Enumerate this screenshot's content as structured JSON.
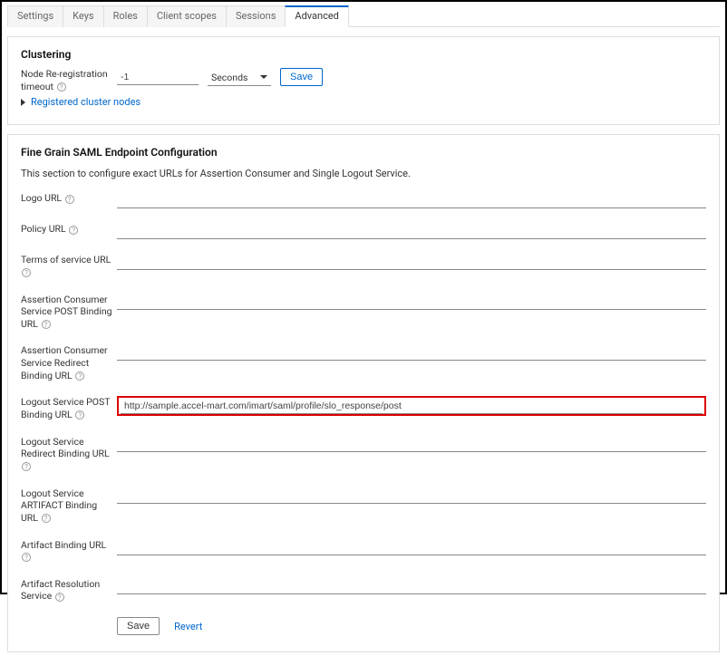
{
  "tabs": {
    "settings": "Settings",
    "keys": "Keys",
    "roles": "Roles",
    "client_scopes": "Client scopes",
    "sessions": "Sessions",
    "advanced": "Advanced"
  },
  "clustering": {
    "title": "Clustering",
    "node_rereg_label": "Node Re-registration timeout",
    "node_rereg_value": "-1",
    "unit_selected": "Seconds",
    "save_label": "Save",
    "registered_nodes_label": "Registered cluster nodes"
  },
  "saml": {
    "title": "Fine Grain SAML Endpoint Configuration",
    "description": "This section to configure exact URLs for Assertion Consumer and Single Logout Service.",
    "fields": {
      "logo_url": {
        "label": "Logo URL",
        "value": ""
      },
      "policy_url": {
        "label": "Policy URL",
        "value": ""
      },
      "tos_url": {
        "label": "Terms of service URL",
        "value": ""
      },
      "acs_post": {
        "label": "Assertion Consumer Service POST Binding URL",
        "value": ""
      },
      "acs_redirect": {
        "label": "Assertion Consumer Service Redirect Binding URL",
        "value": ""
      },
      "logout_post": {
        "label": "Logout Service POST Binding URL",
        "value": "http://sample.accel-mart.com/imart/saml/profile/slo_response/post"
      },
      "logout_redirect": {
        "label": "Logout Service Redirect Binding URL",
        "value": ""
      },
      "logout_artifact": {
        "label": "Logout Service ARTIFACT Binding URL",
        "value": ""
      },
      "artifact_binding": {
        "label": "Artifact Binding URL",
        "value": ""
      },
      "artifact_resolution": {
        "label": "Artifact Resolution Service",
        "value": ""
      }
    },
    "save_label": "Save",
    "revert_label": "Revert"
  }
}
